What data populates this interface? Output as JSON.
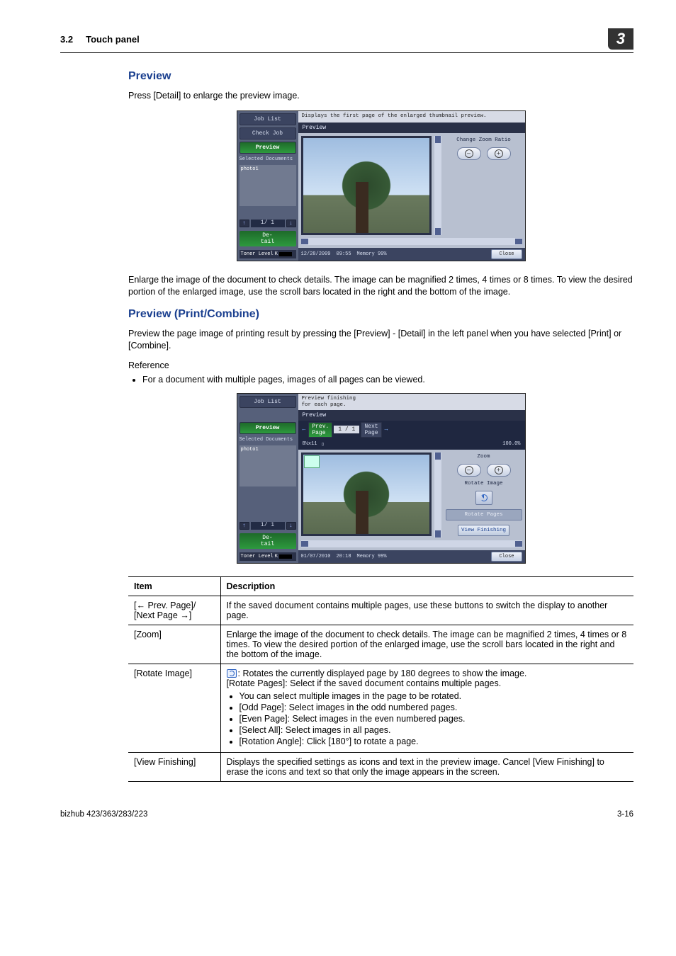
{
  "header": {
    "section_num": "3.2",
    "section_title": "Touch panel",
    "chapter_badge": "3"
  },
  "preview": {
    "heading": "Preview",
    "intro": "Press [Detail] to enlarge the preview image.",
    "after_panel": "Enlarge the image of the document to check details. The image can be magnified 2 times, 4 times or 8 times. To view the desired portion of the enlarged image, use the scroll bars located in the right and the bottom of the image."
  },
  "panel1": {
    "tabs": {
      "job_list": "Job List",
      "check_job": "Check Job",
      "preview": "Preview"
    },
    "selected_documents": "Selected Documents",
    "doc_name": "photo1",
    "pager": "1/  1",
    "detail_btn": "De-\ntail",
    "toner": "Toner Level",
    "toner_k": "K",
    "msg": "Displays the first page of the enlarged thumbnail preview.",
    "title": "Preview",
    "zoom_label": "Change Zoom Ratio",
    "footer": {
      "date": "12/28/2009",
      "time": "09:55",
      "mem_label": "Memory",
      "mem_val": "99%",
      "close": "Close"
    }
  },
  "preview_pc": {
    "heading": "Preview (Print/Combine)",
    "intro": "Preview the page image of printing result by pressing the [Preview] - [Detail] in the left panel when you have selected [Print] or [Combine].",
    "reference_label": "Reference",
    "reference_bullet": "For a document with multiple pages, images of all pages can be viewed."
  },
  "panel2": {
    "tabs": {
      "job_list": "Job List",
      "preview": "Preview"
    },
    "selected_documents": "Selected Documents",
    "doc_name": "photo1",
    "pager": "1/  1",
    "detail_btn": "De-\ntail",
    "toner": "Toner Level",
    "toner_k": "K",
    "msg": "Preview finishing\nfor each page.",
    "title": "Preview",
    "prev_page": "Prev.\nPage",
    "next_page": "Next\nPage",
    "page_num": "1 /    1",
    "size": "8½x11",
    "ratio": "100.0%",
    "zoom_label": "Zoom",
    "rotate_image": "Rotate Image",
    "rotate_pages": "Rotate Pages",
    "view_finishing": "View Finishing",
    "footer": {
      "date": "01/07/2010",
      "time": "20:18",
      "mem_label": "Memory",
      "mem_val": "99%",
      "close": "Close"
    }
  },
  "table": {
    "head_item": "Item",
    "head_desc": "Description",
    "rows": {
      "prevnext": {
        "item": "[← Prev. Page]/\n[Next Page →]",
        "desc": "If the saved document contains multiple pages, use these buttons to switch the display to another page."
      },
      "zoom": {
        "item": "[Zoom]",
        "desc": "Enlarge the image of the document to check details. The image can be magnified 2 times, 4 times or 8 times. To view the desired portion of the enlarged image, use the scroll bars located in the right and the bottom of the image."
      },
      "rotate": {
        "item": "[Rotate Image]",
        "lead": "Rotates the currently displayed page by 180 degrees to show the image.",
        "rp": "[Rotate Pages]: Select if the saved document contains multiple pages.",
        "b1": "You can select multiple images in the page to be rotated.",
        "b2": "[Odd Page]: Select images in the odd numbered pages.",
        "b3": "[Even Page]: Select images in the even numbered pages.",
        "b4": "[Select All]: Select images in all pages.",
        "b5": "[Rotation Angle]: Click [180°] to rotate a page."
      },
      "viewfin": {
        "item": "[View Finishing]",
        "desc": "Displays the specified settings as icons and text in the preview image. Cancel [View Finishing] to erase the icons and text so that only the image appears in the screen."
      }
    }
  },
  "footer": {
    "left": "bizhub 423/363/283/223",
    "right": "3-16"
  }
}
